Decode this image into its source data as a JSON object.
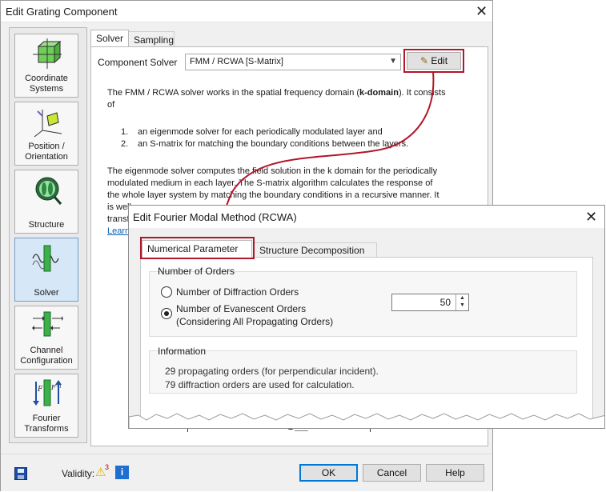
{
  "back": {
    "title": "Edit Grating Component",
    "nav": [
      {
        "label": "Coordinate Systems",
        "icon": "coordinate-cube-icon"
      },
      {
        "label": "Position / Orientation",
        "icon": "position-axes-icon"
      },
      {
        "label": "Structure",
        "icon": "structure-lens-icon"
      },
      {
        "label": "Solver",
        "icon": "solver-wave-icon"
      },
      {
        "label": "Channel Configuration",
        "icon": "channel-arrows-icon"
      },
      {
        "label": "Fourier Transforms",
        "icon": "fourier-transform-icon"
      }
    ],
    "tabs": [
      "Solver",
      "Sampling"
    ],
    "component_solver_label": "Component Solver",
    "component_solver_value": "FMM / RCWA [S-Matrix]",
    "edit_label": "Edit",
    "desc_pre": "The FMM / RCWA solver works in the spatial frequency domain (",
    "desc_bold": "k-domain",
    "desc_post": "). It consists",
    "desc_of": "of",
    "list": [
      {
        "num": "1.",
        "text": "an eigenmode solver for each periodically modulated layer and"
      },
      {
        "num": "2.",
        "text": "an S-matrix for matching the boundary conditions between the layers."
      }
    ],
    "para2": [
      "The eigenmode solver computes the field solution in the k domain for the periodically",
      "modulated medium in each layer. The S-matrix algorithm calculates the response of",
      "the whole layer system by matching the boundary conditions in a recursive manner. It",
      "is well",
      "transf"
    ],
    "learn_link": "Learn",
    "validity_label": "Validity:",
    "validity_count": "3",
    "ok_label": "OK",
    "cancel_label": "Cancel",
    "help_label": "Help",
    "partial_text": "S__"
  },
  "front": {
    "title": "Edit Fourier Modal Method (RCWA)",
    "tabs": [
      "Numerical Parameter",
      "Structure Decomposition"
    ],
    "group_orders_title": "Number of Orders",
    "option1": "Number of Diffraction Orders",
    "option2_line1": "Number of Evanescent Orders",
    "option2_line2": "(Considering All Propagating Orders)",
    "evanescent_value": "50",
    "group_info_title": "Information",
    "info1": "29 propagating orders (for perpendicular incident).",
    "info2": "79 diffraction orders are used for calculation."
  },
  "colors": {
    "highlight": "#b1162a",
    "link": "#0b5fb5",
    "selected": "#d6e7f7"
  }
}
